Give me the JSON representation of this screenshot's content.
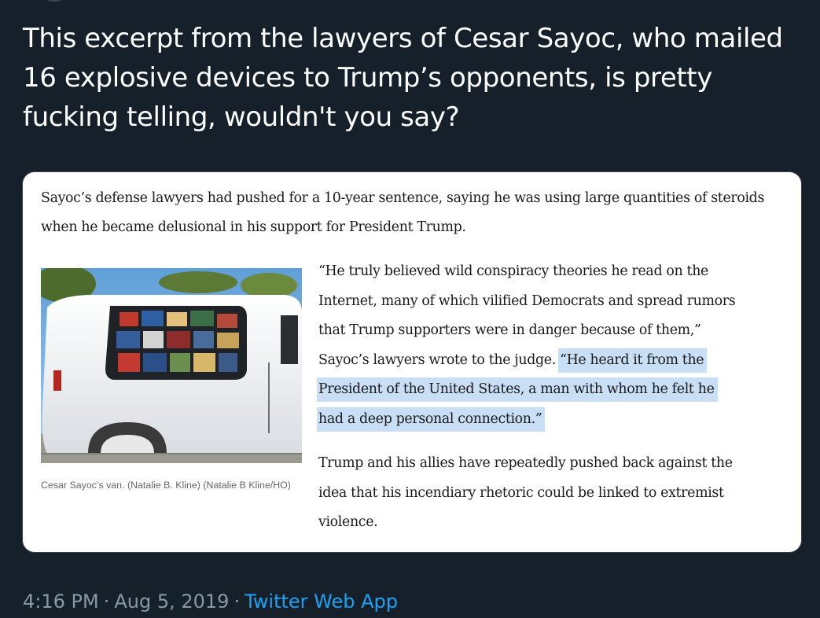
{
  "tweet": {
    "text": "This excerpt from the lawyers of Cesar Sayoc, who mailed 16 explosive devices to Trump’s opponents, is pretty fucking telling, wouldn't you say?",
    "time": "4:16 PM",
    "separator": "·",
    "date": "Aug 5, 2019",
    "source": "Twitter Web App"
  },
  "article": {
    "lead": "Sayoc’s defense lawyers had pushed for a 10-year sentence, saying he was using large quantities of steroids when he became delusional in his support for President Trump.",
    "photo_caption": "Cesar Sayoc’s van. (Natalie B. Kline) (Natalie B Kline/HO)",
    "quote_lines": [
      "“He truly believed wild conspiracy theories he read on the",
      "Internet, many of which vilified Democrats and spread rumors",
      "that Trump supporters were in danger because of them,”",
      "Sayoc’s lawyers wrote to the judge. "
    ],
    "highlight_lines": [
      "“He heard it from the",
      "President of the United States, a man with whom he felt he",
      "had a deep personal connection.”"
    ],
    "follow_lines": [
      "Trump and his allies have repeatedly pushed back against the",
      "idea that his incendiary rhetoric could be linked to extremist",
      "violence."
    ]
  },
  "colors": {
    "background": "#15202b",
    "highlight": "#c9dff6",
    "link": "#1da1f2",
    "meta_text": "#8899a6"
  }
}
